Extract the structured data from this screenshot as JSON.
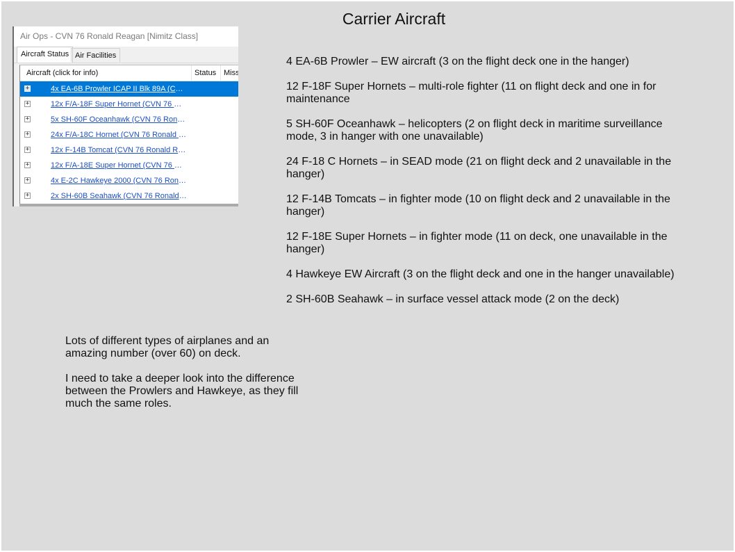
{
  "slide": {
    "title": "Carrier Aircraft"
  },
  "screenshot": {
    "window_title": "Air Ops - CVN 76 Ronald Reagan [Nimitz Class]",
    "tabs": [
      {
        "label": "Aircraft Status",
        "active": true
      },
      {
        "label": "Air Facilities",
        "active": false
      }
    ],
    "columns": [
      "Aircraft (click for info)",
      "Status",
      "Miss"
    ],
    "rows": [
      {
        "label": "4x EA-6B Prowler ICAP II Blk 89A (CVN...",
        "selected": true
      },
      {
        "label": "12x F/A-18F Super Hornet (CVN 76 Ro...",
        "selected": false
      },
      {
        "label": "5x SH-60F Oceanhawk (CVN 76 Ronal...",
        "selected": false
      },
      {
        "label": "24x F/A-18C Hornet (CVN 76 Ronald R...",
        "selected": false
      },
      {
        "label": "12x F-14B Tomcat (CVN 76 Ronald Re...",
        "selected": false
      },
      {
        "label": "12x F/A-18E Super Hornet (CVN 76 Ro...",
        "selected": false
      },
      {
        "label": "4x E-2C Hawkeye 2000 (CVN 76 Ronal...",
        "selected": false
      },
      {
        "label": "2x SH-60B Seahawk (CVN 76 Ronald ...",
        "selected": false
      }
    ],
    "expander_glyph": "+"
  },
  "notes": [
    "4 EA-6B Prowler – EW aircraft (3 on the flight deck one in the hanger)",
    "12 F-18F Super Hornets – multi-role fighter (11 on flight deck and one in for maintenance",
    "5 SH-60F Oceanhawk – helicopters (2 on flight deck in maritime surveillance mode, 3 in hanger with one unavailable)",
    "24 F-18 C Hornets – in SEAD mode (21 on flight deck and 2 unavailable in the hanger)",
    "12 F-14B Tomcats – in fighter mode (10 on flight deck and 2 unavailable in the hanger)",
    "12 F-18E Super Hornets – in fighter mode (11 on deck, one unavailable in the hanger)",
    "4 Hawkeye EW Aircraft (3 on the flight deck and one in the hanger unavailable)",
    "2 SH-60B Seahawk – in surface vessel attack mode (2 on the deck)"
  ],
  "comments": [
    "Lots of different types of airplanes and an amazing number (over 60) on deck.",
    "I need to take a deeper look into the difference between the Prowlers and Hawkeye, as they fill much the same roles."
  ]
}
